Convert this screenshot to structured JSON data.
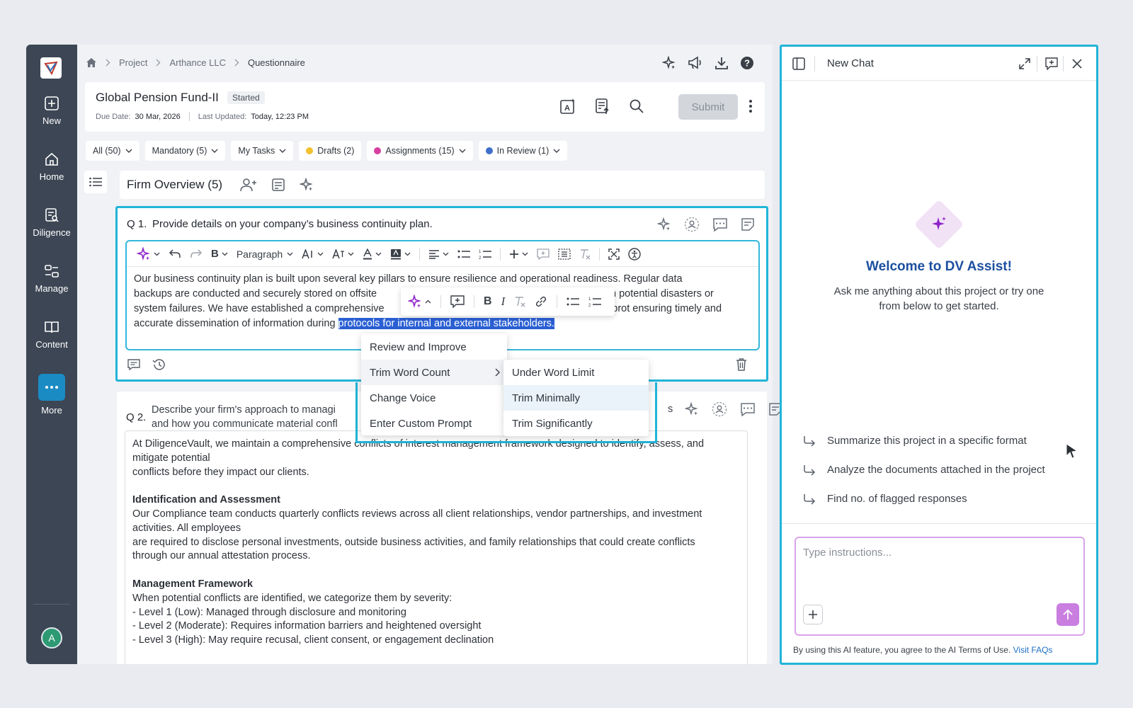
{
  "sidebar": {
    "items": [
      {
        "label": "New",
        "icon": "plus-square-icon"
      },
      {
        "label": "Home",
        "icon": "home-icon"
      },
      {
        "label": "Diligence",
        "icon": "diligence-icon"
      },
      {
        "label": "Manage",
        "icon": "manage-icon"
      },
      {
        "label": "Content",
        "icon": "book-icon"
      },
      {
        "label": "More",
        "icon": "more-dots-icon"
      }
    ],
    "avatar_initial": "A"
  },
  "breadcrumb": [
    "Project",
    "Arthance LLC",
    "Questionnaire"
  ],
  "header": {
    "title": "Global Pension Fund-II",
    "status": "Started",
    "due_label": "Due Date:",
    "due_value": "30 Mar, 2026",
    "updated_label": "Last Updated:",
    "updated_value": "Today, 12:23 PM",
    "submit_label": "Submit"
  },
  "filters": [
    {
      "label": "All (50)"
    },
    {
      "label": "Mandatory (5)"
    },
    {
      "label": "My Tasks"
    },
    {
      "label": "Drafts (2)",
      "color": "#f2c12e"
    },
    {
      "label": "Assignments (15)",
      "color": "#d63fa0"
    },
    {
      "label": "In Review (1)",
      "color": "#3f6fc9"
    }
  ],
  "section": {
    "title": "Firm Overview (5)"
  },
  "q1": {
    "number": "Q 1.",
    "text": "Provide details on your company’s business continuity plan.",
    "toolbar": {
      "paragraph": "Paragraph"
    },
    "body_line1": "Our business continuity plan is built upon several key pillars to ensure resilience and operational readiness. Regular data",
    "body_line2a": "backups are conducted and securely stored on offsite",
    "body_line2b": "n potential disasters or",
    "body_line3a": "system failures. We have established a comprehensive",
    "body_line3b": "s prot  ensuring timely and",
    "body_line4a": "accurate dissemination of information during",
    "body_selected": "protocols for internal and external stakeholders."
  },
  "ai_menu": {
    "items": [
      "Review and Improve",
      "Trim Word Count",
      "Change Voice",
      "Enter Custom Prompt"
    ],
    "submenu": [
      "Under Word Limit",
      "Trim Minimally",
      "Trim Significantly"
    ]
  },
  "q2": {
    "number": "Q 2.",
    "text_line1": "Describe your firm's approach to managi",
    "text_line2": "and how you communicate material confl",
    "text_tail": "s",
    "body": [
      {
        "t": "At DiligenceVault, we maintain a comprehensive conflicts of interest management framework designed to identify, assess, and"
      },
      {
        "t": "mitigate potential"
      },
      {
        "t": "conflicts before they impact our clients."
      },
      {
        "t": ""
      },
      {
        "t": "Identification and Assessment",
        "h": true
      },
      {
        "t": "Our Compliance team conducts quarterly conflicts reviews across all client  relationships, vendor partnerships, and investment"
      },
      {
        "t": "activities. All employees"
      },
      {
        "t": "are required to disclose personal investments, outside business activities,  and family relationships that could create conflicts"
      },
      {
        "t": "through our annual attestation process."
      },
      {
        "t": ""
      },
      {
        "t": "Management Framework",
        "h": true
      },
      {
        "t": "When potential conflicts are identified, we categorize them by severity:"
      },
      {
        "t": "- Level 1 (Low): Managed through disclosure and monitoring"
      },
      {
        "t": "- Level 2 (Moderate): Requires information barriers and heightened oversight"
      },
      {
        "t": "- Level 3 (High): May require recusal, client consent, or engagement declination"
      }
    ]
  },
  "chat": {
    "title": "New Chat",
    "welcome_title": "Welcome to DV Assist!",
    "welcome_sub": "Ask me anything about this project or try one from below to get started.",
    "suggestions": [
      "Summarize this project in a specific format",
      "Analyze the documents attached in the project",
      "Find no. of flagged responses"
    ],
    "input_placeholder": "Type instructions...",
    "terms_text": "By using this AI feature, you agree to the AI Terms of Use.",
    "terms_link": "Visit FAQs"
  },
  "colors": {
    "accent": "#21b4d8",
    "selection": "#2a5fd3",
    "ai_purple": "#8e24c9",
    "brand_blue": "#1c4fa0"
  }
}
